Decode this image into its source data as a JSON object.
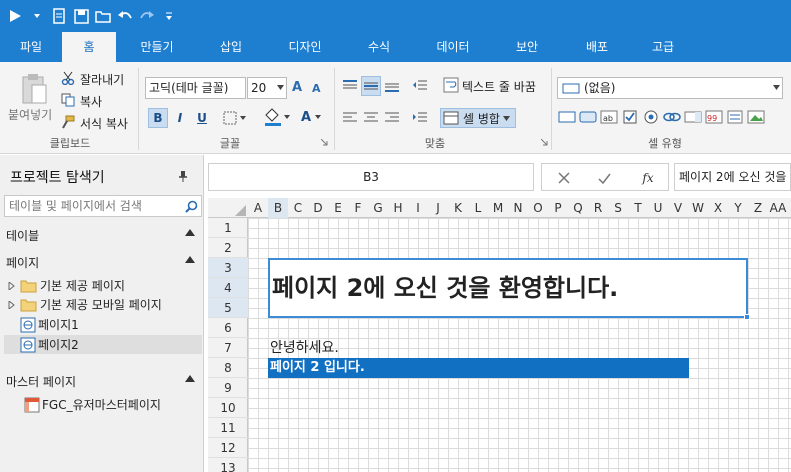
{
  "ribbon_tabs": [
    {
      "label": "파일",
      "active": false
    },
    {
      "label": "홈",
      "active": true
    },
    {
      "label": "만들기",
      "active": false
    },
    {
      "label": "삽입",
      "active": false
    },
    {
      "label": "디자인",
      "active": false
    },
    {
      "label": "수식",
      "active": false
    },
    {
      "label": "데이터",
      "active": false
    },
    {
      "label": "보안",
      "active": false
    },
    {
      "label": "배포",
      "active": false
    },
    {
      "label": "고급",
      "active": false
    }
  ],
  "clipboard": {
    "paste": "붙여넣기",
    "cut": "잘라내기",
    "copy": "복사",
    "format_copy": "서식 복사",
    "group": "클립보드"
  },
  "font": {
    "family": "고딕(테마 글꼴)",
    "size": "20",
    "bold": "B",
    "italic": "I",
    "underline": "U",
    "group": "글꼴",
    "grow": "A",
    "shrink": "A",
    "color": "A"
  },
  "align": {
    "wrap": "텍스트 줄 바꿈",
    "merge": "셀 병합",
    "group": "맞춤"
  },
  "celltype": {
    "style": "(없음)",
    "group": "셀 유형"
  },
  "explorer": {
    "title": "프로젝트 탐색기",
    "search_placeholder": "테이블 및 페이지에서 검색",
    "tables": "테이블",
    "pages": "페이지",
    "page_items": [
      "기본 제공 페이지",
      "기본 제공 모바일 페이지",
      "페이지1",
      "페이지2"
    ],
    "master": "마스터 페이지",
    "master_items": [
      "FGC_유저마스터페이지"
    ]
  },
  "formula": {
    "cell_ref": "B3",
    "fx": "fx",
    "value": "페이지 2에 오신 것을 환영합니다."
  },
  "columns": [
    "A",
    "B",
    "C",
    "D",
    "E",
    "F",
    "G",
    "H",
    "I",
    "J",
    "K",
    "L",
    "M",
    "N",
    "O",
    "P",
    "Q",
    "R",
    "S",
    "T",
    "U",
    "V",
    "W",
    "X",
    "Y",
    "Z",
    "AA"
  ],
  "rows": [
    "1",
    "2",
    "3",
    "4",
    "5",
    "6",
    "7",
    "8",
    "9",
    "10",
    "11",
    "12",
    "13"
  ],
  "cells": {
    "title": "페이지 2에 오신 것을 환영합니다.",
    "hello": "안녕하세요.",
    "bar": "페이지 2 입니다."
  },
  "colors": {
    "accent": "#1e7fd1",
    "selection": "#3c8bd6",
    "bar": "#1270c2"
  }
}
